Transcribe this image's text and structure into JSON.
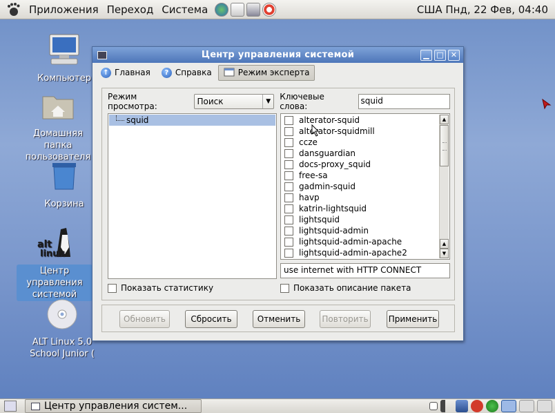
{
  "top_panel": {
    "menus": [
      "Приложения",
      "Переход",
      "Система"
    ],
    "clock": "США Пнд, 22 Фев, 04:40"
  },
  "desktop": {
    "icons": [
      {
        "label": "Компьютер",
        "icon": "computer-icon"
      },
      {
        "label": "Домашняя папка пользователя",
        "icon": "home-folder-icon"
      },
      {
        "label": "Корзина",
        "icon": "trash-icon"
      },
      {
        "label": "Центр управления системой",
        "icon": "alt-linux-logo"
      },
      {
        "label": "ALT Linux 5.0 School Junior (",
        "icon": "cd-disc-icon"
      }
    ]
  },
  "window": {
    "title": "Центр управления системой",
    "toolbar": {
      "home": "Главная",
      "help": "Справка",
      "expert": "Режим эксперта"
    },
    "view_mode_label": "Режим просмотра:",
    "view_mode_value": "Поиск",
    "keywords_label": "Ключевые слова:",
    "keywords_value": "squid",
    "tree": [
      "squid"
    ],
    "packages": [
      "alterator-squid",
      "alterator-squidmill",
      "ccze",
      "dansguardian",
      "docs-proxy_squid",
      "free-sa",
      "gadmin-squid",
      "havp",
      "katrin-lightsquid",
      "lightsquid",
      "lightsquid-admin",
      "lightsquid-admin-apache",
      "lightsquid-admin-apache2"
    ],
    "package_description": "use internet with HTTP CONNECT",
    "show_stats_label": "Показать статистику",
    "show_desc_label": "Показать описание пакета",
    "buttons": {
      "update": "Обновить",
      "reset": "Сбросить",
      "cancel": "Отменить",
      "retry": "Повторить",
      "apply": "Применить"
    }
  },
  "taskbar": {
    "task_label": "Центр управления систем..."
  },
  "colors": {
    "titlebar": "#4d76b9",
    "selection": "#a9c0e3",
    "desktop": "#7a97cc"
  }
}
